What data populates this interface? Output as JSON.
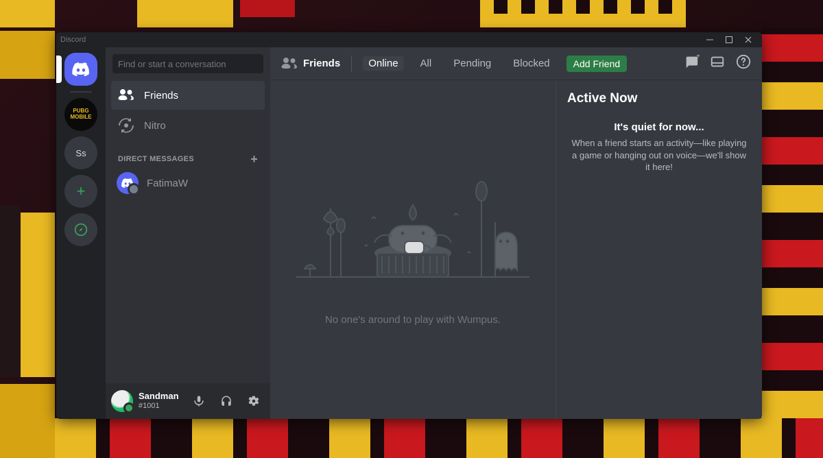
{
  "window": {
    "title": "Discord"
  },
  "servers": {
    "pubg_label": "PUBG\nMOBILE",
    "ss_label": "Ss"
  },
  "sidebar": {
    "search_placeholder": "Find or start a conversation",
    "friends_label": "Friends",
    "nitro_label": "Nitro",
    "dm_header": "DIRECT MESSAGES",
    "dms": [
      {
        "name": "FatimaW"
      }
    ]
  },
  "userbar": {
    "name": "Sandman",
    "tag": "#1001"
  },
  "topbar": {
    "title": "Friends",
    "tabs": {
      "online": "Online",
      "all": "All",
      "pending": "Pending",
      "blocked": "Blocked"
    },
    "add_friend": "Add Friend"
  },
  "empty": {
    "text": "No one's around to play with Wumpus."
  },
  "active_now": {
    "header": "Active Now",
    "title": "It's quiet for now...",
    "body": "When a friend starts an activity—like playing a game or hanging out on voice—we'll show it here!"
  }
}
